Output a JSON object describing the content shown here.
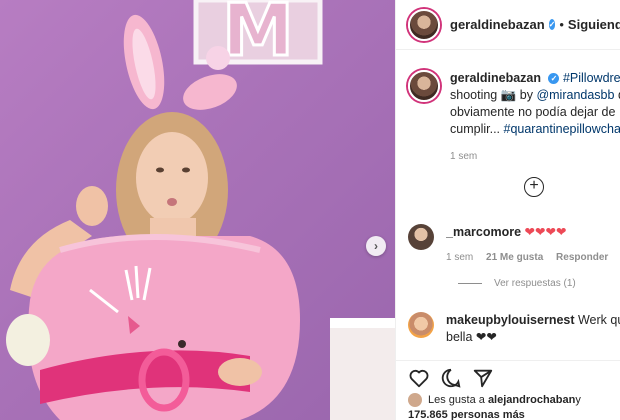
{
  "post": {
    "username": "geraldinebazan",
    "verified_mark": "✓",
    "follow_state": "Siguiendo",
    "separator": "•"
  },
  "caption": {
    "username": "geraldinebazan",
    "tag1": "#Pillowdress",
    "text1": " shooting 📷 by ",
    "mention": "@mirandasbb",
    "text2": " que",
    "line2": "obviamente no podía dejar de",
    "line3": "cumplir... ",
    "tag2": "#quarantinepillowchalle",
    "time": "1 sem"
  },
  "add_comment_symbol": "+",
  "comments": [
    {
      "username": "_marcomore",
      "text": "❤❤❤❤",
      "time": "1 sem",
      "likes": "21 Me gusta",
      "reply": "Responder",
      "view_replies": "Ver respuestas (1)"
    },
    {
      "username": "makeupbylouisernest",
      "text": " Werk que",
      "text_line2": "bella ❤❤"
    }
  ],
  "likes": {
    "prefix": "Les gusta a ",
    "user": "alejandrochaban",
    "suffix": " y",
    "count": "175.865 personas más"
  },
  "photo": {
    "letter": "M",
    "next_symbol": "›"
  },
  "colors": {
    "wall": "#a972b8",
    "pillow": "#f4a7c8",
    "link": "#00376b",
    "verified": "#3897f0",
    "heart": "#ed4956"
  }
}
